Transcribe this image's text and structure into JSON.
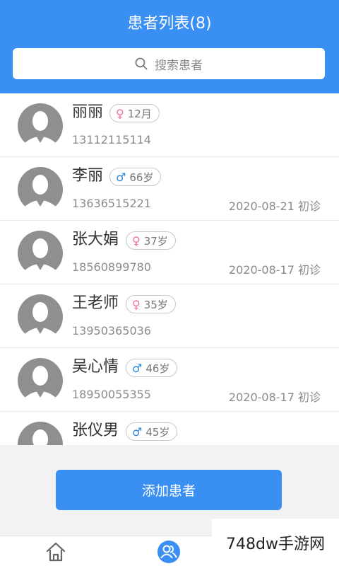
{
  "header": {
    "title": "患者列表(8)"
  },
  "search": {
    "placeholder": "搜索患者"
  },
  "patients": [
    {
      "name": "丽丽",
      "gender": "female",
      "gender_symbol": "♀",
      "age": "12月",
      "phone": "13112115114",
      "visit": ""
    },
    {
      "name": "李丽",
      "gender": "male",
      "gender_symbol": "♂",
      "age": "66岁",
      "phone": "13636515221",
      "visit": "2020-08-21 初诊"
    },
    {
      "name": "张大娟",
      "gender": "female",
      "gender_symbol": "♀",
      "age": "37岁",
      "phone": "18560899780",
      "visit": "2020-08-17 初诊"
    },
    {
      "name": "王老师",
      "gender": "female",
      "gender_symbol": "♀",
      "age": "35岁",
      "phone": "13950365036",
      "visit": ""
    },
    {
      "name": "吴心情",
      "gender": "male",
      "gender_symbol": "♂",
      "age": "46岁",
      "phone": "18950055355",
      "visit": "2020-08-17 初诊"
    },
    {
      "name": "张仪男",
      "gender": "male",
      "gender_symbol": "♂",
      "age": "45岁",
      "phone": "",
      "visit": ""
    }
  ],
  "footer": {
    "add_label": "添加患者"
  },
  "tabbar": {
    "items": [
      {
        "icon": "home-icon"
      },
      {
        "icon": "patients-icon",
        "active": true
      }
    ]
  },
  "watermark": {
    "text": "748dw手游网"
  },
  "colors": {
    "primary": "#3a8ff2",
    "female": "#ef6f97",
    "male": "#2e88d8"
  }
}
